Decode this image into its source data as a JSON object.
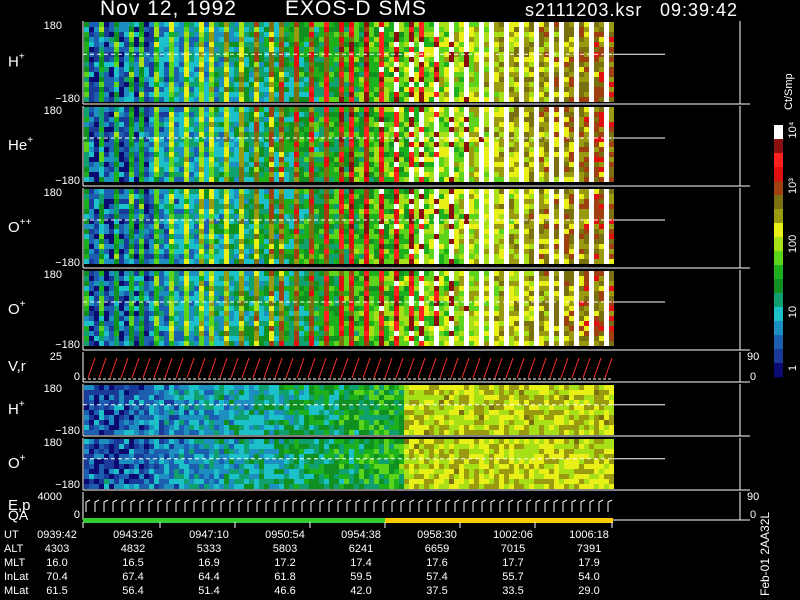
{
  "header": {
    "date": "Nov 12, 1992",
    "instrument": "EXOS-D SMS",
    "file": "s2111203.ksr",
    "time": "09:39:42"
  },
  "colors": {
    "background": "#000000",
    "dashed_line": "#ffffff",
    "pitch_marker": "#ff3030",
    "energy_marker": "#ffffff",
    "qa_green": "#33cc33",
    "qa_yellow": "#ffcc00"
  },
  "chart_data": {
    "type": "heatmap",
    "title": "Nov 12, 1992    EXOS-D SMS",
    "colorbar": {
      "unit": "Ct/Smp",
      "tick_labels": [
        "1",
        "10",
        "100",
        "10³",
        "10⁴"
      ],
      "scale": "log",
      "range": [
        1,
        10000
      ],
      "colors": [
        "#0a0a70",
        "#1a3a9a",
        "#1c5fb0",
        "#1c8fc0",
        "#1cc0c8",
        "#10a070",
        "#109020",
        "#1cb01c",
        "#5cd41c",
        "#a8e018",
        "#e8f018",
        "#9a9a10",
        "#7a7010",
        "#a04010",
        "#e01010",
        "#ff2020",
        "#8a1010",
        "#ffffff"
      ]
    },
    "panels": [
      {
        "label": "H",
        "sup": "+",
        "ymin": "−180",
        "ymax": "180",
        "kind": "pitch_spectrogram",
        "right_label": ""
      },
      {
        "label": "He",
        "sup": "+",
        "ymin": "−180",
        "ymax": "180",
        "kind": "pitch_spectrogram",
        "right_label": ""
      },
      {
        "label": "O",
        "sup": "++",
        "ymin": "−180",
        "ymax": "180",
        "kind": "pitch_spectrogram",
        "right_label": ""
      },
      {
        "label": "O",
        "sup": "+",
        "ymin": "−180",
        "ymax": "180",
        "kind": "pitch_spectrogram",
        "right_label": ""
      },
      {
        "label": "V,r",
        "sup": "",
        "ymin": "0",
        "ymax": "25",
        "kind": "line_panel",
        "right_top": "90",
        "right_bottom": "0"
      },
      {
        "label": "H",
        "sup": "+",
        "ymin": "−180",
        "ymax": "180",
        "kind": "pitch_spectrogram",
        "right_label": ""
      },
      {
        "label": "O",
        "sup": "+",
        "ymin": "−180",
        "ymax": "180",
        "kind": "pitch_spectrogram",
        "right_label": ""
      },
      {
        "label": "E,p",
        "sup": "",
        "ymin": "0",
        "ymax": "4000",
        "kind": "line_panel",
        "right_top": "90",
        "right_bottom": "0",
        "label2": "QA"
      }
    ],
    "x_axis": {
      "start": "0939:42",
      "end": "1006:18"
    }
  },
  "table": {
    "rows": [
      {
        "label": "UT",
        "values": [
          "0939:42",
          "0943:26",
          "0947:10",
          "0950:54",
          "0954:38",
          "0958:30",
          "1002:06",
          "1006:18"
        ]
      },
      {
        "label": "ALT",
        "values": [
          "4303",
          "4832",
          "5333",
          "5803",
          "6241",
          "6659",
          "7015",
          "7391"
        ]
      },
      {
        "label": "MLT",
        "values": [
          "16.0",
          "16.5",
          "16.9",
          "17.2",
          "17.4",
          "17.6",
          "17.7",
          "17.9"
        ]
      },
      {
        "label": "InLat",
        "values": [
          "70.4",
          "67.4",
          "64.4",
          "61.8",
          "59.5",
          "57.4",
          "55.7",
          "54.0"
        ]
      },
      {
        "label": "MLat",
        "values": [
          "61.5",
          "56.4",
          "51.4",
          "46.6",
          "42.0",
          "37.5",
          "33.5",
          "29.0"
        ]
      }
    ]
  },
  "footer": {
    "date_code": "Feb-01  2AA32L"
  }
}
